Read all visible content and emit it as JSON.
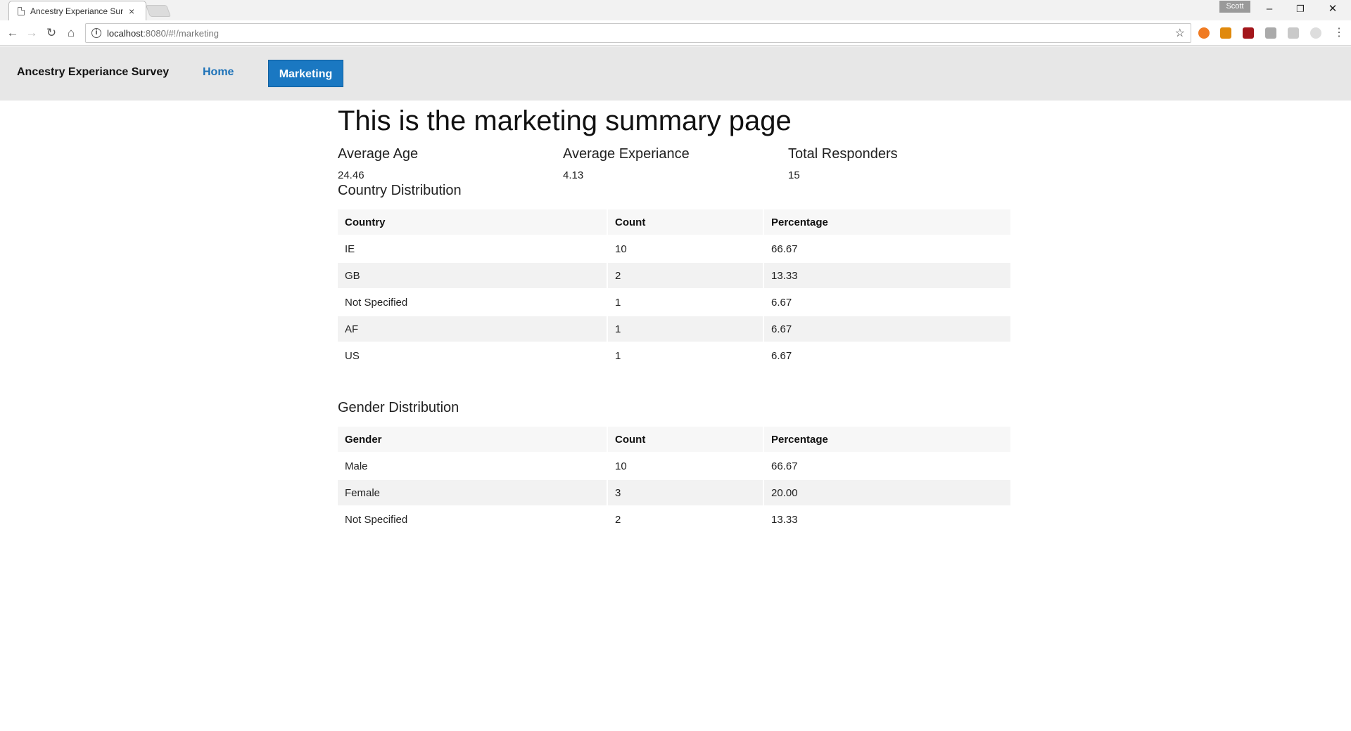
{
  "browser": {
    "tab_title": "Ancestry Experiance Surv",
    "tab_close": "×",
    "profile_name": "Scott",
    "url_host": "localhost",
    "url_rest": ":8080/#!/marketing",
    "minimize_glyph": "–",
    "restore_glyph": "❐",
    "close_glyph": "✕"
  },
  "navbar": {
    "brand": "Ancestry Experiance Survey",
    "home": "Home",
    "marketing": "Marketing",
    "active_color": "#1a78c2"
  },
  "page": {
    "title": "This is the marketing summary page",
    "stats": [
      {
        "label": "Average Age",
        "value": "24.46"
      },
      {
        "label": "Average Experiance",
        "value": "4.13"
      },
      {
        "label": "Total Responders",
        "value": "15"
      }
    ],
    "country": {
      "title": "Country Distribution",
      "headers": [
        "Country",
        "Count",
        "Percentage"
      ],
      "rows": [
        [
          "IE",
          "10",
          "66.67"
        ],
        [
          "GB",
          "2",
          "13.33"
        ],
        [
          "Not Specified",
          "1",
          "6.67"
        ],
        [
          "AF",
          "1",
          "6.67"
        ],
        [
          "US",
          "1",
          "6.67"
        ]
      ]
    },
    "gender": {
      "title": "Gender Distribution",
      "headers": [
        "Gender",
        "Count",
        "Percentage"
      ],
      "rows": [
        [
          "Male",
          "10",
          "66.67"
        ],
        [
          "Female",
          "3",
          "20.00"
        ],
        [
          "Not Specified",
          "2",
          "13.33"
        ]
      ]
    }
  }
}
